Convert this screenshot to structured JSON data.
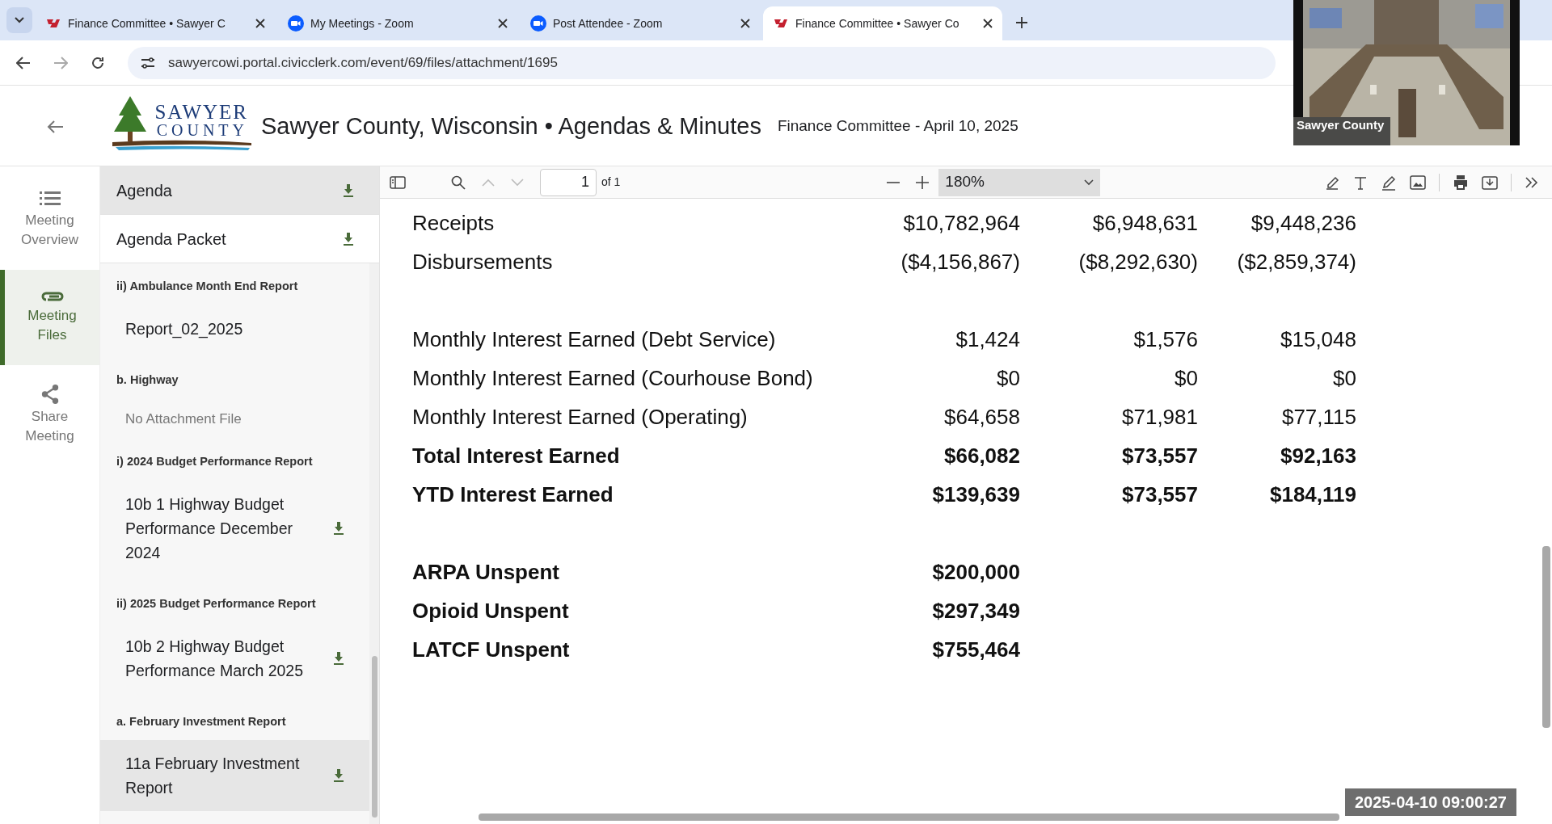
{
  "browser": {
    "tabs": [
      {
        "title": "Finance Committee • Sawyer C",
        "kind": "civic",
        "selected": false
      },
      {
        "title": "My Meetings - Zoom",
        "kind": "zoom",
        "selected": false
      },
      {
        "title": "Post Attendee - Zoom",
        "kind": "zoom",
        "selected": false
      },
      {
        "title": "Finance Committee • Sawyer Co",
        "kind": "civic",
        "selected": true
      }
    ],
    "url": "sawyercowi.portal.civicclerk.com/event/69/files/attachment/1695"
  },
  "header": {
    "logo_top": "SAWYER",
    "logo_bottom": "COUNTY",
    "title": "Sawyer County, Wisconsin • Agendas & Minutes",
    "subtitle": "Finance Committee - April 10, 2025"
  },
  "nav": [
    {
      "label": "Meeting Overview",
      "kind": "list",
      "selected": false
    },
    {
      "label": "Meeting Files",
      "kind": "clip",
      "selected": true
    },
    {
      "label": "Share Meeting",
      "kind": "share",
      "selected": false
    }
  ],
  "sidebar": {
    "top_files": [
      {
        "title": "Agenda",
        "selected": true
      },
      {
        "title": "Agenda Packet",
        "selected": false
      }
    ],
    "sections": [
      {
        "heading": "ii) Ambulance Month End Report",
        "files": [
          {
            "kind": "file",
            "title": "Report_02_2025",
            "download": false,
            "selected": false
          }
        ]
      },
      {
        "heading": "b. Highway",
        "files": [
          {
            "kind": "empty",
            "title": "No Attachment File"
          }
        ]
      },
      {
        "heading": "i) 2024 Budget Performance Report",
        "files": [
          {
            "kind": "file",
            "title": "10b 1 Highway Budget Performance December 2024",
            "download": true,
            "selected": false
          }
        ]
      },
      {
        "heading": "ii) 2025 Budget Performance Report",
        "files": [
          {
            "kind": "file",
            "title": "10b 2 Highway Budget Performance March 2025",
            "download": true,
            "selected": false
          }
        ]
      },
      {
        "heading": "a. February Investment Report",
        "files": [
          {
            "kind": "file",
            "title": "11a February Investment Report",
            "download": true,
            "selected": true
          }
        ]
      }
    ]
  },
  "pdf_toolbar": {
    "page": "1",
    "page_count": "of 1",
    "zoom": "180%"
  },
  "document": {
    "groups": [
      [
        {
          "label": "Receipts",
          "values": [
            "$10,782,964",
            "$6,948,631",
            "$9,448,236"
          ],
          "bold": false
        },
        {
          "label": "Disbursements",
          "values": [
            "($4,156,867)",
            "($8,292,630)",
            "($2,859,374)"
          ],
          "bold": false
        }
      ],
      [
        {
          "label": "Monthly Interest Earned (Debt Service)",
          "values": [
            "$1,424",
            "$1,576",
            "$15,048"
          ],
          "bold": false
        },
        {
          "label": "Monthly Interest Earned (Courhouse Bond)",
          "values": [
            "$0",
            "$0",
            "$0"
          ],
          "bold": false
        },
        {
          "label": "Monthly Interest Earned (Operating)",
          "values": [
            "$64,658",
            "$71,981",
            "$77,115"
          ],
          "bold": false
        },
        {
          "label": "Total Interest Earned",
          "values": [
            "$66,082",
            "$73,557",
            "$92,163"
          ],
          "bold": true
        },
        {
          "label": "YTD Interest Earned",
          "values": [
            "$139,639",
            "$73,557",
            "$184,119"
          ],
          "bold": true
        }
      ],
      [
        {
          "label": "ARPA Unspent",
          "values": [
            "$200,000"
          ],
          "bold": true
        },
        {
          "label": "Opioid Unspent",
          "values": [
            "$297,349"
          ],
          "bold": true
        },
        {
          "label": "LATCF Unspent",
          "values": [
            "$755,464"
          ],
          "bold": true
        }
      ]
    ]
  },
  "video": {
    "caption": "Sawyer County"
  },
  "timestamp": "2025-04-10 09:00:27"
}
